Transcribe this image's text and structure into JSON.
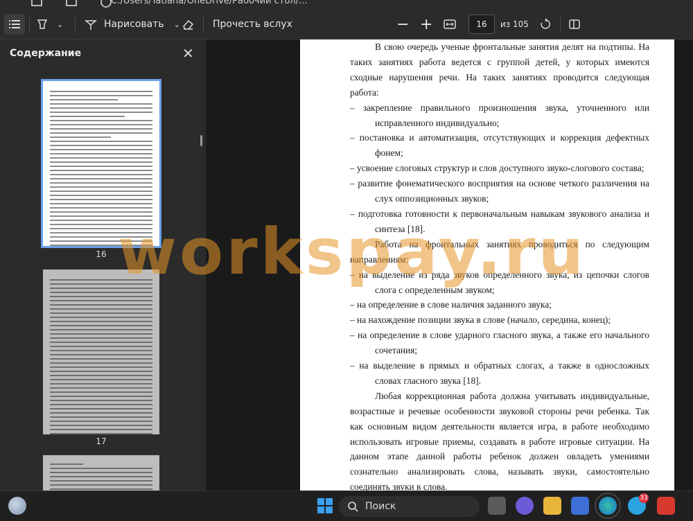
{
  "topbar": {
    "address": "C:/Users/Tatiana/OneDrive/Рабочий стол/..."
  },
  "toolbar": {
    "draw_label": "Нарисовать",
    "read_aloud_label": "Прочесть вслух",
    "page_number": "16",
    "page_total": "из 105"
  },
  "sidebar": {
    "title": "Содержание",
    "thumbs": [
      {
        "label": "16"
      },
      {
        "label": "17"
      }
    ]
  },
  "document": {
    "paragraphs": [
      {
        "kind": "ind",
        "text": "В свою очередь ученые фронтальные занятия делят на подтипы. На таких занятиях работа ведется с группой детей, у которых имеются сходные нарушения речи. На таких занятиях проводится следующая работа:"
      },
      {
        "kind": "li",
        "text": "– закрепление правильного произношения звука, уточненного или исправленного индивидуально;"
      },
      {
        "kind": "li",
        "text": "– постановка и автоматизация, отсутствующих и коррекция дефектных фонем;"
      },
      {
        "kind": "li",
        "text": "– усвоение слоговых структур и слов доступного звуко-слогового состава;"
      },
      {
        "kind": "li",
        "text": "– развитие фонематического восприятия на основе четкого различения на слух оппозиционных звуков;"
      },
      {
        "kind": "li",
        "text": "– подготовка готовности к первоначальным навыкам звукового анализа и синтеза [18]."
      },
      {
        "kind": "ind",
        "text": "Работа на фронтальных занятиях проводиться по следующим направлениям:"
      },
      {
        "kind": "li",
        "text": "– на выделение из ряда звуков определенного звука, из цепочки слогов слога с определенным звуком;"
      },
      {
        "kind": "li",
        "text": "– на определение в слове наличия заданного звука;"
      },
      {
        "kind": "li",
        "text": "– на нахождение позиции звука в слове (начало, середина, конец);"
      },
      {
        "kind": "li",
        "text": "– на определение в слове ударного гласного звука, а также его начального сочетания;"
      },
      {
        "kind": "li",
        "text": "– на выделение в прямых и обратных слогах, а также в односложных словах гласного звука [18]."
      },
      {
        "kind": "ind",
        "text": "Любая коррекционная работа должна учитывать индивидуальные, возрастные и речевые особенности звуковой стороны речи ребенка. Так как основным видом деятельности является игра, в работе необходимо использовать игровые приемы, создавать в работе игровые ситуации. На данном этапе данной работы ребенок должен овладеть умениями сознательно анализировать слова, называть звуки, самостоятельно соединять звуки в слова."
      }
    ]
  },
  "watermark": "workspay.ru",
  "taskbar": {
    "search_label": "Поиск",
    "telegram_badge": "33"
  },
  "colors": {
    "accent": "#6aa0e8",
    "watermark": "#e6962a"
  }
}
